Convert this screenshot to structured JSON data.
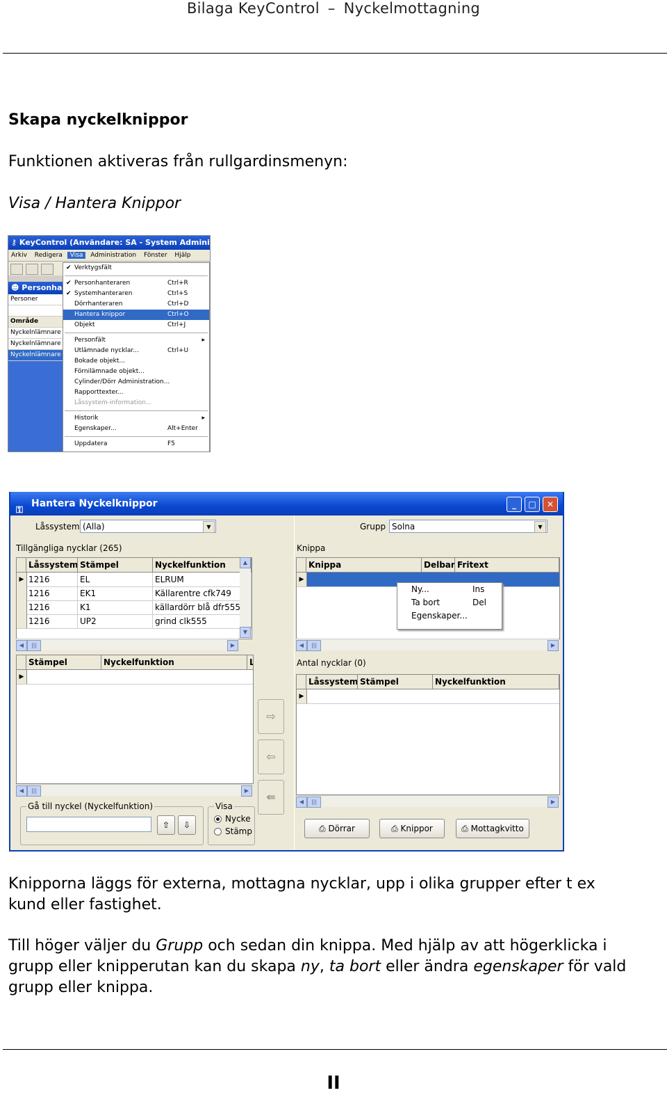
{
  "header": {
    "left": "Bilaga KeyControl",
    "right": "Nyckelmottagning"
  },
  "heading": "Skapa nyckelknippor",
  "intro": "Funktionen aktiveras från rullgardinsmenyn:",
  "menu_path": "Visa / Hantera Knippor",
  "shot1": {
    "title": "KeyControl   (Användare: SA - System Administratö",
    "menubar": [
      "Arkiv",
      "Redigera",
      "Visa",
      "Administration",
      "Fönster",
      "Hjälp"
    ],
    "left_title": "Personhan",
    "left_rows": [
      "Personer",
      "",
      "Område",
      "Nyckelnlämnare",
      "Nyckelnlämnare",
      "Nyckelnlämnare"
    ],
    "menu_items": [
      {
        "label": "Verktygsfält",
        "shortcut": "",
        "checked": true
      },
      {
        "label": "Personhanteraren",
        "shortcut": "Ctrl+R",
        "checked": true
      },
      {
        "label": "Systemhanteraren",
        "shortcut": "Ctrl+S",
        "checked": true
      },
      {
        "label": "Dörrhanteraren",
        "shortcut": "Ctrl+D",
        "checked": false
      },
      {
        "label": "Hantera knippor",
        "shortcut": "Ctrl+O",
        "checked": false
      },
      {
        "label": "Objekt",
        "shortcut": "Ctrl+J",
        "checked": false
      },
      {
        "label": "Personfält",
        "shortcut": "",
        "checked": false
      },
      {
        "label": "Utlämnade nycklar...",
        "shortcut": "Ctrl+U",
        "checked": false
      },
      {
        "label": "Bokade objekt...",
        "shortcut": "",
        "checked": false
      },
      {
        "label": "Förnilämnade objekt...",
        "shortcut": "",
        "checked": false
      },
      {
        "label": "Cylinder/Dörr Administration...",
        "shortcut": "",
        "checked": false
      },
      {
        "label": "Rapporttexter...",
        "shortcut": "",
        "checked": false
      },
      {
        "label": "Låssystem-information...",
        "shortcut": "",
        "checked": false
      },
      {
        "label": "Historik",
        "shortcut": "",
        "checked": false
      },
      {
        "label": "Egenskaper...",
        "shortcut": "Alt+Enter",
        "checked": false
      },
      {
        "label": "Uppdatera",
        "shortcut": "F5",
        "checked": false
      }
    ]
  },
  "shot2": {
    "title": "Hantera Nyckelknippor",
    "lassystem_label": "Låssystem",
    "lassystem_value": "(Alla)",
    "grupp_label": "Grupp",
    "grupp_value": "Solna",
    "tillgangliga": "Tillgängliga nycklar (265)",
    "left_headers": [
      "Låssystem",
      "Stämpel",
      "Nyckelfunktion"
    ],
    "left_rows": [
      [
        "1216",
        "EL",
        "ELRUM"
      ],
      [
        "1216",
        "EK1",
        "Källarentre cfk749"
      ],
      [
        "1216",
        "K1",
        "källardörr blå dfr555"
      ],
      [
        "1216",
        "UP2",
        "grind clk555"
      ]
    ],
    "lower_headers": [
      "Stämpel",
      "Nyckelfunktion",
      "L"
    ],
    "knippa_label": "Knippa",
    "knippa_headers": [
      "Knippa",
      "Delbar",
      "Fritext"
    ],
    "ctx": [
      {
        "label": "Ny...",
        "shortcut": "Ins"
      },
      {
        "label": "Ta bort",
        "shortcut": "Del"
      },
      {
        "label": "Egenskaper...",
        "shortcut": ""
      }
    ],
    "antal": "Antal nycklar (0)",
    "lower_right_headers": [
      "Låssystem",
      "Stämpel",
      "Nyckelfunktion"
    ],
    "goto_label": "Gå till nyckel (Nyckelfunktion)",
    "visa_label": "Visa",
    "visa_opts": [
      "Nycke",
      "Stämp"
    ],
    "buttons": [
      "Dörrar",
      "Knippor",
      "Mottagkvitto"
    ]
  },
  "para1": "Knipporna läggs för externa, mottagna nycklar, upp i olika grupper efter t ex kund eller fastighet.",
  "para2": {
    "a": "Till höger väljer du ",
    "b": "Grupp",
    "c": " och sedan din knippa. Med hjälp av att högerklicka i grupp eller knipperutan kan du skapa ",
    "d": "ny",
    "e": ", ",
    "f": "ta bort",
    "g": " eller ändra ",
    "h": "egenskaper",
    "i": " för vald grupp eller knippa."
  },
  "page_number": "II"
}
